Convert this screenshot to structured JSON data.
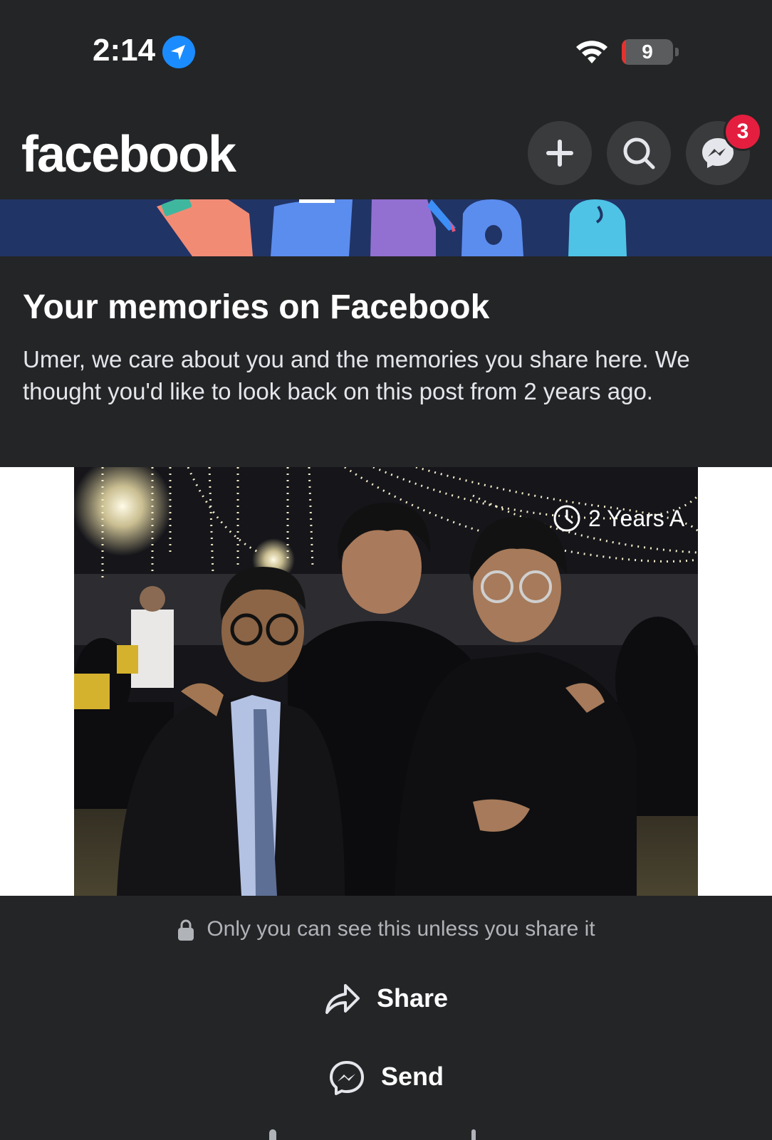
{
  "status_bar": {
    "time": "2:14",
    "battery_percent": 9,
    "battery_label": "9"
  },
  "header": {
    "logo": "facebook",
    "messenger_badge": "3"
  },
  "memories": {
    "title": "Your memories on Facebook",
    "description": "Umer, we care about you and the memories you share here. We thought you'd like to look back on this post from 2 years ago."
  },
  "photo": {
    "stamp": "2 Years A"
  },
  "privacy": {
    "text": "Only you can see this unless you share it"
  },
  "actions": {
    "share_label": "Share",
    "send_label": "Send"
  },
  "icons": {
    "location": "location-arrow-icon",
    "wifi": "wifi-icon",
    "add": "plus-icon",
    "search": "search-icon",
    "messenger": "messenger-icon",
    "clock": "clock-icon",
    "lock": "lock-icon",
    "share": "share-arrow-icon",
    "send": "messenger-icon"
  },
  "colors": {
    "background": "#242526",
    "button_bg": "#3a3b3c",
    "badge": "#e41e3f",
    "location_blue": "#1a8cff",
    "battery_low": "#e5322f",
    "banner_bg": "#213466"
  }
}
